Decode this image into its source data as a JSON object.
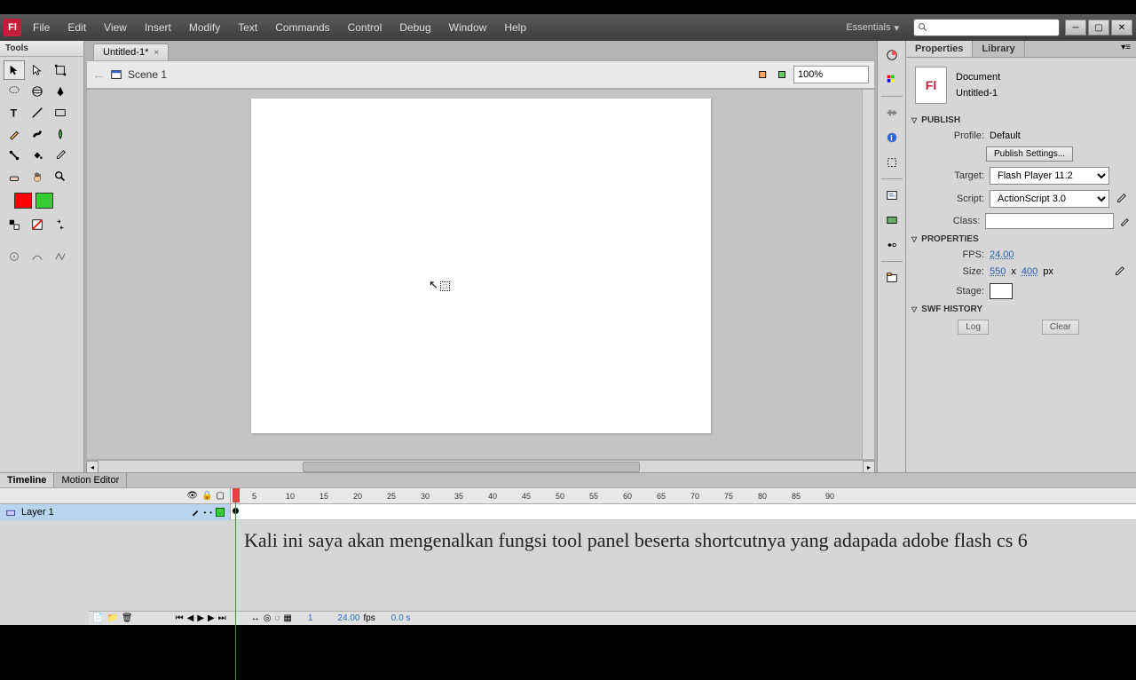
{
  "app": {
    "logo_text": "Fl",
    "menus": [
      "File",
      "Edit",
      "View",
      "Insert",
      "Modify",
      "Text",
      "Commands",
      "Control",
      "Debug",
      "Window",
      "Help"
    ],
    "workspace": "Essentials"
  },
  "doc_tab": {
    "title": "Untitled-1*"
  },
  "scene": {
    "back": "←",
    "name": "Scene 1",
    "zoom": "100%"
  },
  "tools_title": "Tools",
  "swatches": {
    "stroke": "#ff0000",
    "fill": "#33cc33"
  },
  "timeline": {
    "tabs": [
      "Timeline",
      "Motion Editor"
    ],
    "layer": "Layer 1",
    "ticks": [
      5,
      10,
      15,
      20,
      25,
      30,
      35,
      40,
      45,
      50,
      55,
      60,
      65,
      70,
      75,
      80,
      85,
      90
    ],
    "fps": "24.00",
    "fps_lbl": "fps",
    "time": "0.0 s",
    "frame": "1"
  },
  "properties": {
    "tabs": [
      "Properties",
      "Library"
    ],
    "doc_icon": "Fl",
    "type": "Document",
    "name": "Untitled-1",
    "sections": {
      "publish": "PUBLISH",
      "props": "PROPERTIES",
      "swf": "SWF HISTORY"
    },
    "publish": {
      "profile_lbl": "Profile:",
      "profile": "Default",
      "settings_btn": "Publish Settings...",
      "target_lbl": "Target:",
      "target": "Flash Player 11.2",
      "script_lbl": "Script:",
      "script": "ActionScript 3.0",
      "class_lbl": "Class:"
    },
    "props": {
      "fps_lbl": "FPS:",
      "fps": "24.00",
      "size_lbl": "Size:",
      "w": "550",
      "x": "x",
      "h": "400",
      "px": "px",
      "stage_lbl": "Stage:"
    },
    "swf": {
      "log_btn": "Log",
      "clear_btn": "Clear"
    }
  },
  "subtitle": "Kali ini saya akan mengenalkan fungsi tool panel beserta shortcutnya yang adapada adobe flash cs 6"
}
